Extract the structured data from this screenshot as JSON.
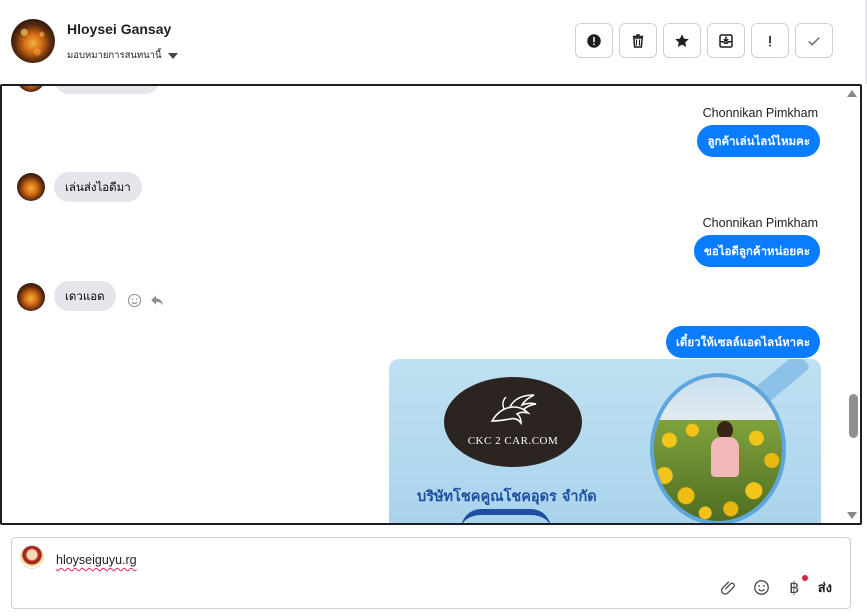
{
  "header": {
    "contact_name": "Hloysei Gansay",
    "assign_label": "มอบหมายการสนทนานี้",
    "toolbar": [
      {
        "name": "mark-spam-button",
        "icon": "alert-circle-icon"
      },
      {
        "name": "delete-button",
        "icon": "trash-icon"
      },
      {
        "name": "star-button",
        "icon": "star-icon"
      },
      {
        "name": "archive-button",
        "icon": "archive-icon"
      },
      {
        "name": "follow-up-button",
        "icon": "exclamation-icon"
      },
      {
        "name": "done-button",
        "icon": "check-icon"
      }
    ]
  },
  "messages": {
    "m1_sender": "Chonnikan Pimkham",
    "m1_text": "ลูกค้าเล่นไลน์ไหมคะ",
    "m2_text": "เล่นส่งไอดีมา",
    "m3_sender": "Chonnikan Pimkham",
    "m3_text": "ขอไอดีลูกค้าหน่อยคะ",
    "m4_text": "เดวแอด",
    "m5_text": "เดี๋ยวให้เซลล์แอดไลน์หาคะ"
  },
  "attachment": {
    "logo_text": "CKC 2 CAR.COM",
    "company_text": "บริษัทโชคคูณโชคอุดร จำกัด"
  },
  "composer": {
    "draft_text": "hloyseiguyu.rg",
    "send_label": "ส่ง",
    "currency_symbol": "฿"
  },
  "colors": {
    "outgoing_bubble": "#0a7cff",
    "incoming_bubble": "#e4e6eb",
    "notification_dot": "#e41e3f"
  }
}
